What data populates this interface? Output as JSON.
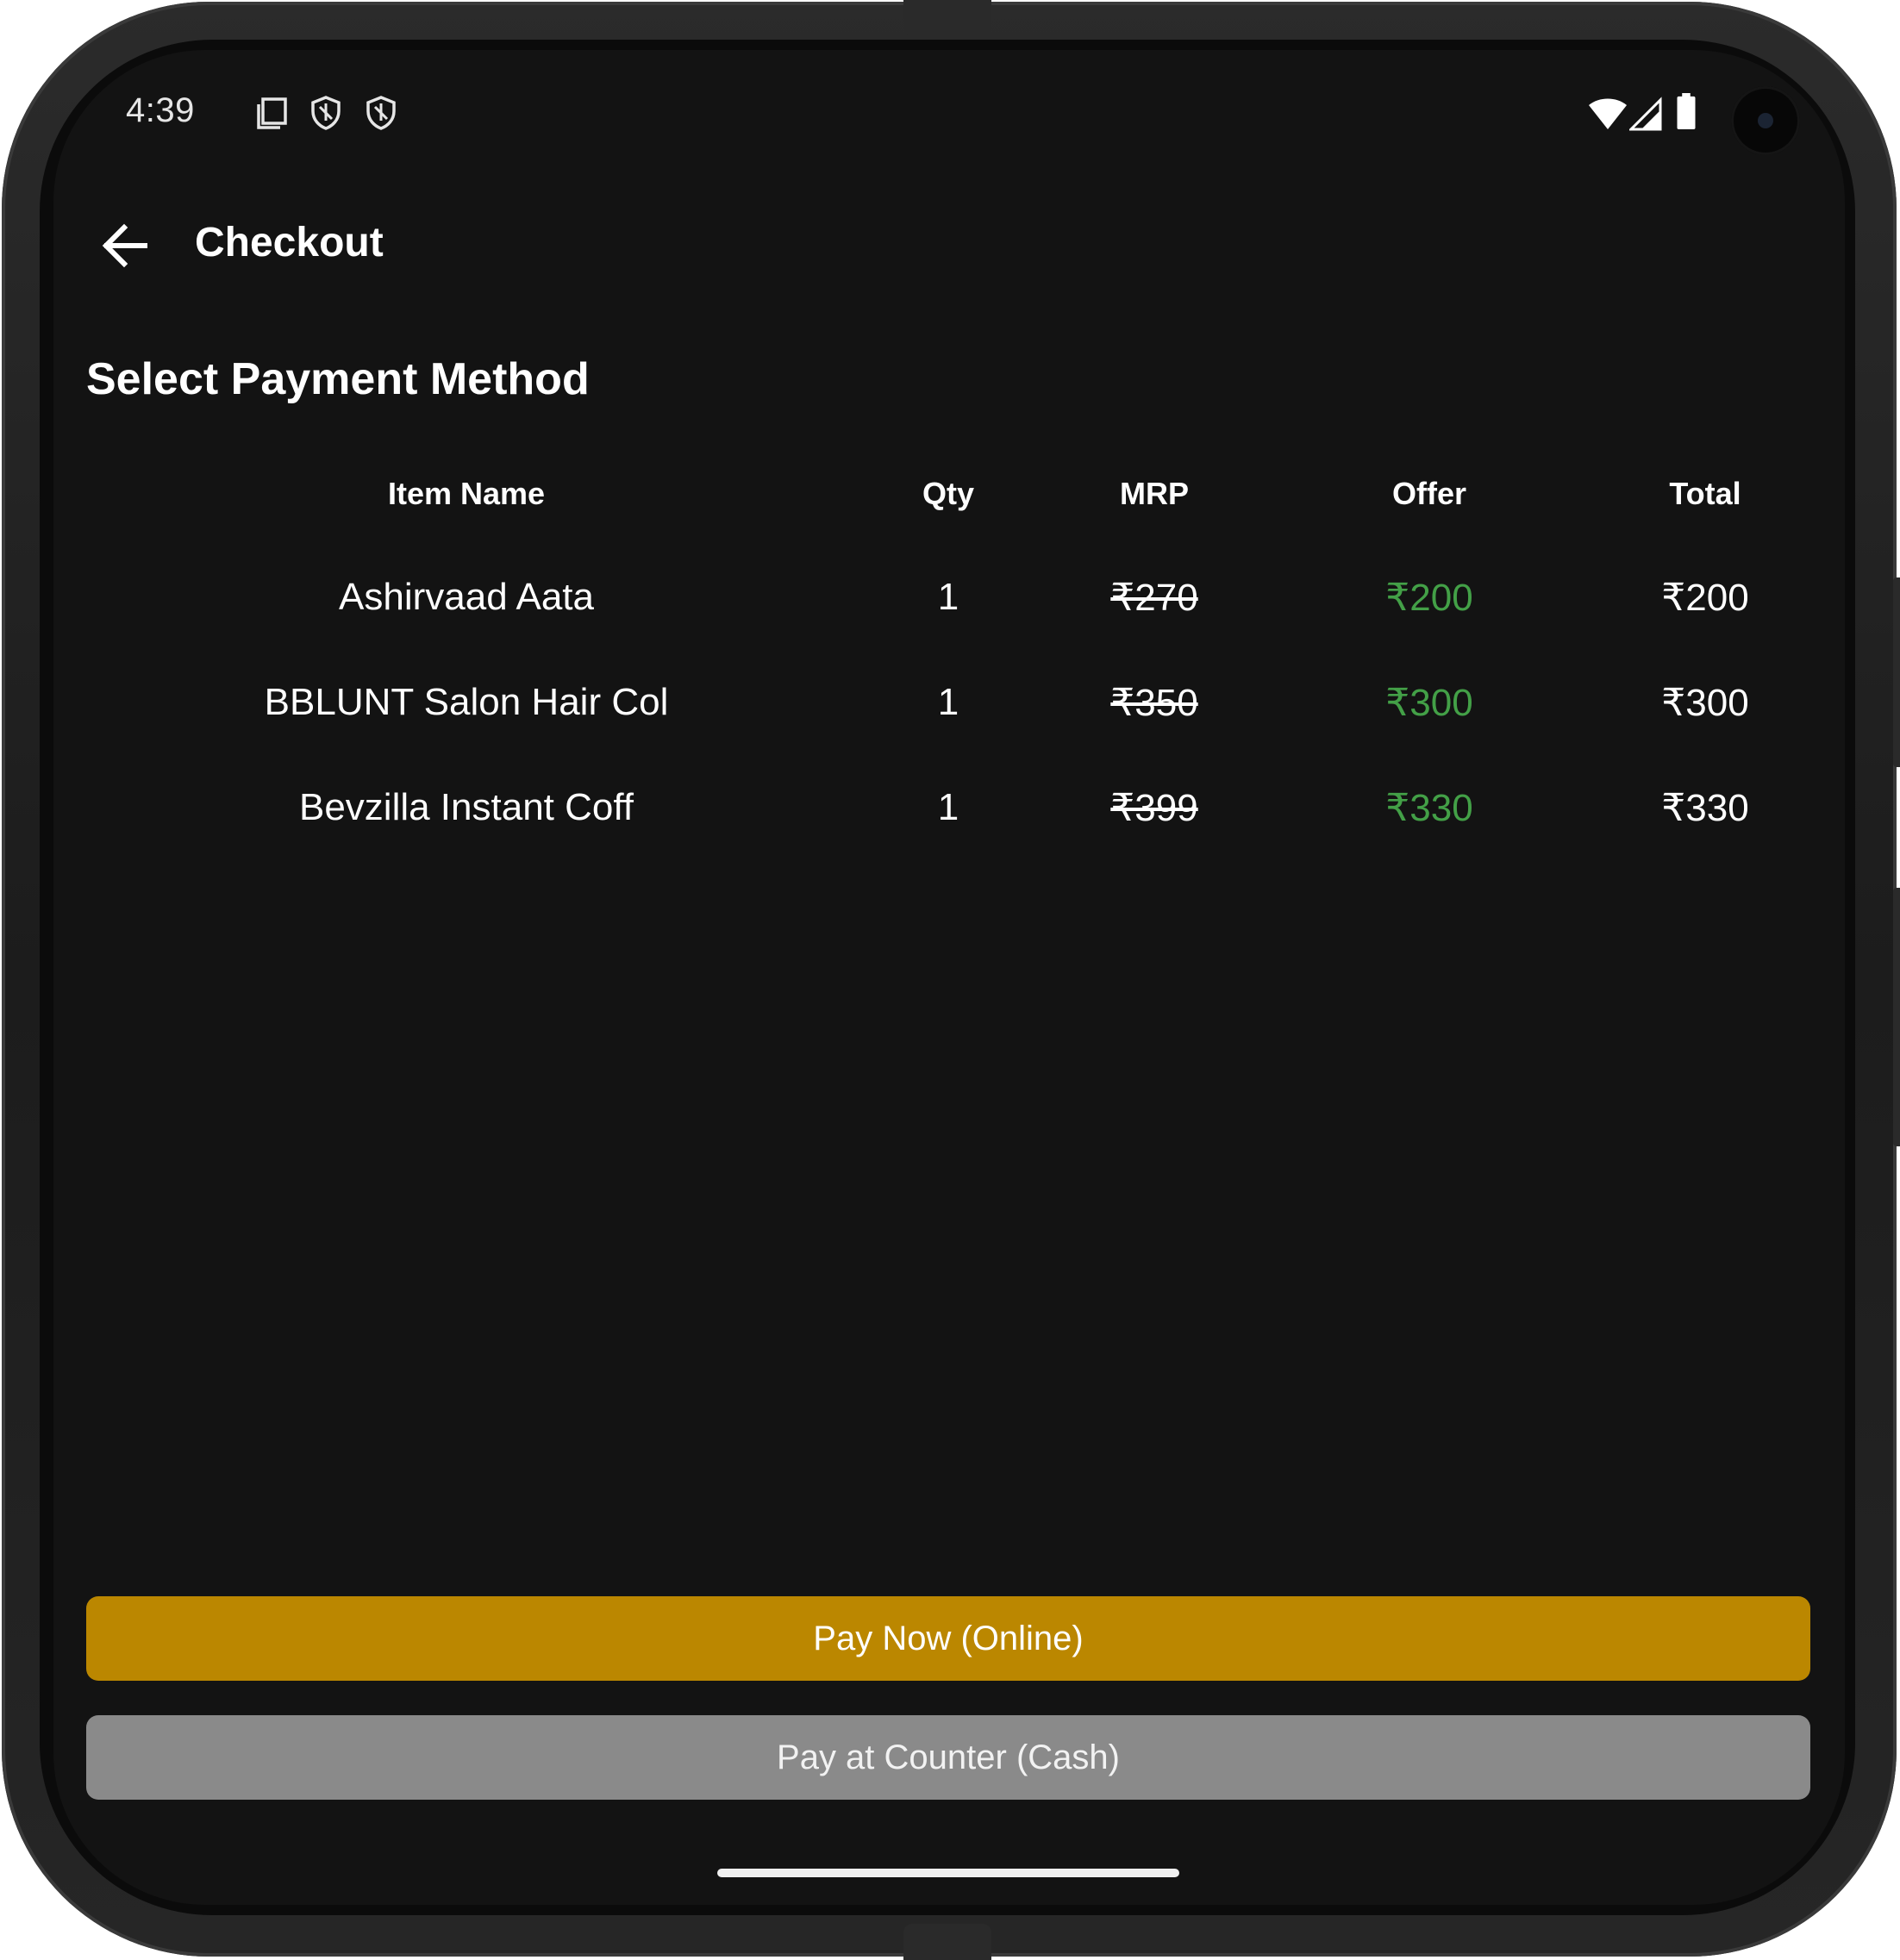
{
  "status_bar": {
    "time": "4:39",
    "left_icons": [
      "screenshot-icon",
      "shield-icon",
      "shield-icon"
    ],
    "right_icons": [
      "wifi-icon",
      "signal-icon",
      "battery-icon"
    ]
  },
  "app_bar": {
    "title": "Checkout",
    "back_icon": "arrow-back-icon"
  },
  "section_title": "Select Payment Method",
  "table": {
    "headers": [
      "Item Name",
      "Qty",
      "MRP",
      "Offer",
      "Total"
    ],
    "rows": [
      {
        "name": "Ashirvaad Aata",
        "qty": "1",
        "mrp": "₹270",
        "offer": "₹200",
        "total": "₹200"
      },
      {
        "name": "BBLUNT Salon Hair Col",
        "qty": "1",
        "mrp": "₹350",
        "offer": "₹300",
        "total": "₹300"
      },
      {
        "name": "Bevzilla Instant Coff",
        "qty": "1",
        "mrp": "₹399",
        "offer": "₹330",
        "total": "₹330"
      }
    ]
  },
  "buttons": {
    "pay_online": "Pay Now (Online)",
    "pay_cash": "Pay at Counter (Cash)"
  },
  "colors": {
    "background": "#131313",
    "accent": "#bb8700",
    "offer_green": "#43a047",
    "secondary_button": "#8a8a8a"
  }
}
